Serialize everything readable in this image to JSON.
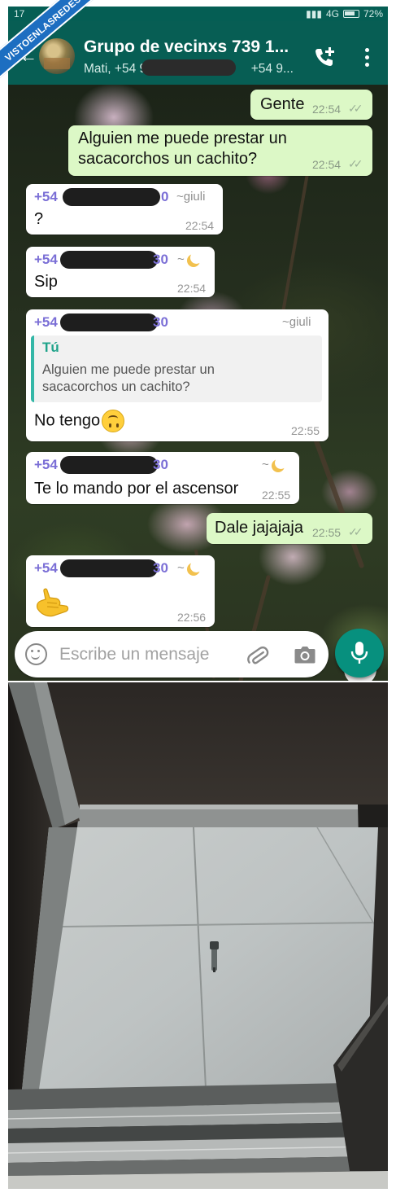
{
  "status_bar": {
    "time": "17",
    "network": "4G",
    "battery": "72%"
  },
  "header": {
    "title": "Grupo de vecinxs 739 1...",
    "subtitle_start": "Mati, +54 9",
    "subtitle_end": "+54 9..."
  },
  "messages": [
    {
      "direction": "out",
      "text": "Gente",
      "time": "22:54",
      "status": "read"
    },
    {
      "direction": "out",
      "lines": [
        "Alguien me puede prestar un",
        "sacacorchos un cachito?"
      ],
      "time": "22:54",
      "status": "read"
    },
    {
      "direction": "in",
      "sender_prefix": "+54",
      "sender_suffix": "0",
      "alias": "~giuli",
      "text": "?",
      "time": "22:54"
    },
    {
      "direction": "in",
      "sender_prefix": "+54",
      "sender_suffix": "30",
      "alias": "~",
      "text": "Sip",
      "time": "22:54"
    },
    {
      "direction": "in",
      "sender_prefix": "+54",
      "sender_suffix": "30",
      "alias": "~giuli",
      "quote": {
        "name": "Tú",
        "lines": [
          "Alguien me puede prestar un",
          "sacacorchos un cachito?"
        ]
      },
      "text": "No tengo",
      "emoji": "upside-down-face",
      "time": "22:55"
    },
    {
      "direction": "in",
      "sender_prefix": "+54",
      "sender_suffix": "30",
      "alias": "~",
      "text": "Te lo mando por el ascensor",
      "time": "22:55"
    },
    {
      "direction": "out",
      "text": "Dale jajajaja",
      "time": "22:55",
      "status": "read"
    },
    {
      "direction": "in",
      "sender_prefix": "+54",
      "sender_suffix": "30",
      "alias": "~",
      "emoji": "call-me-hand",
      "time": "22:56"
    }
  ],
  "compose": {
    "placeholder": "Escribe un mensaje"
  },
  "watermark": {
    "text": "VISTOENLASREDES"
  },
  "ticks": "✓✓",
  "colors": {
    "header": "#075e54",
    "outgoing": "#dcf8c6",
    "incoming": "#ffffff",
    "sender": "#7b6fd6",
    "accent": "#07907e",
    "watermark": "#1d6ec1"
  }
}
